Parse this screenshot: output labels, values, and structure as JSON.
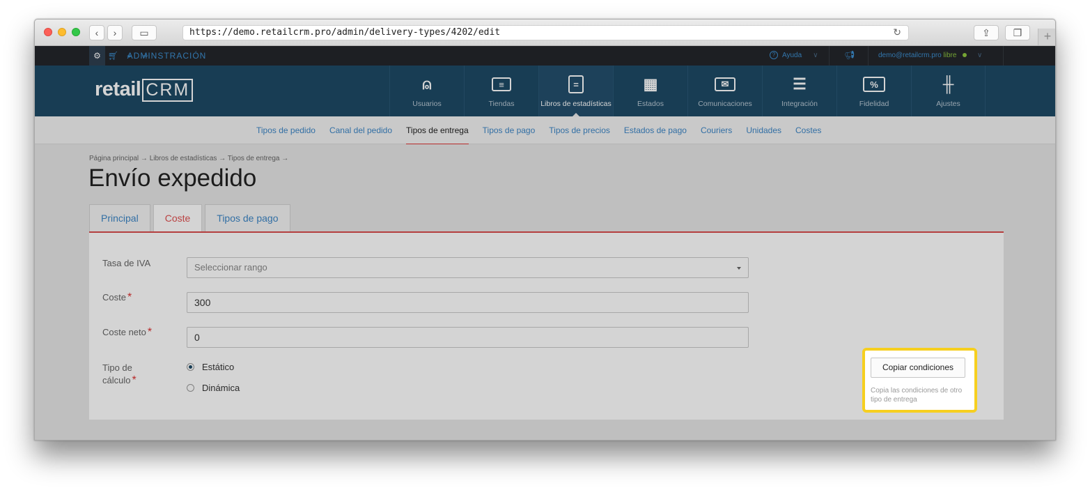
{
  "browser": {
    "url": "https://demo.retailcrm.pro/admin/delivery-types/4202/edit",
    "new_tab": "+"
  },
  "adminbar": {
    "label": "ADMINSTRACIÓN",
    "help": "Ayuda",
    "help_symbol": "?",
    "user_email": "demo@retailcrm.pro",
    "user_plan": "libre"
  },
  "header": {
    "logo_text": "retail",
    "logo_crm": "CRM",
    "nav": [
      {
        "label": "Usuarios",
        "icon": "user-icon",
        "glyph": "⍝"
      },
      {
        "label": "Tiendas",
        "icon": "store-icon",
        "glyph": "≡"
      },
      {
        "label": "Libros de estadísticas",
        "icon": "book-icon",
        "glyph": "="
      },
      {
        "label": "Estados",
        "icon": "grid-icon",
        "glyph": "▦"
      },
      {
        "label": "Comunicaciones",
        "icon": "mail-icon",
        "glyph": "✉"
      },
      {
        "label": "Integración",
        "icon": "integration-icon",
        "glyph": "☰"
      },
      {
        "label": "Fidelidad",
        "icon": "percent-icon",
        "glyph": "%"
      },
      {
        "label": "Ajustes",
        "icon": "sliders-icon",
        "glyph": "╫"
      }
    ]
  },
  "subnav": {
    "items": [
      "Tipos de pedido",
      "Canal del pedido",
      "Tipos de entrega",
      "Tipos de pago",
      "Tipos de precios",
      "Estados de pago",
      "Couriers",
      "Unidades",
      "Costes"
    ]
  },
  "page": {
    "breadcrumb": "Página principal → Libros de estadísticas → Tipos de entrega →",
    "title": "Envío expedido",
    "tabs": [
      "Principal",
      "Coste",
      "Tipos de pago"
    ]
  },
  "form": {
    "vat_label": "Tasa de IVA",
    "vat_placeholder": "Seleccionar rango",
    "cost_label": "Coste",
    "cost_value": "300",
    "net_cost_label": "Coste neto",
    "net_cost_value": "0",
    "calc_type_label_1": "Tipo de",
    "calc_type_label_2": "cálculo",
    "required_mark": "*",
    "calc_options": [
      "Estático",
      "Dinámica"
    ],
    "calc_selected": "Estático"
  },
  "callout": {
    "button": "Copiar condiciones",
    "hint": "Copia las condiciones de otro tipo de entrega"
  }
}
